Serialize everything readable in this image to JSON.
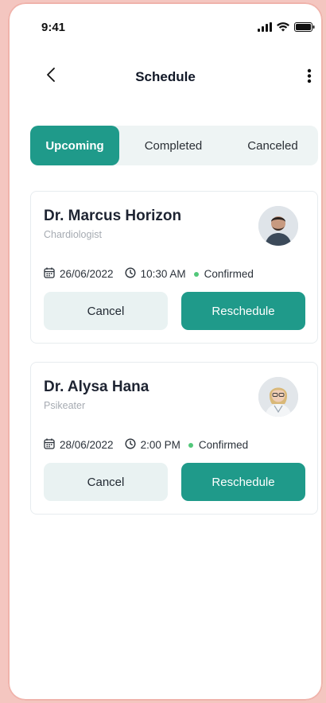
{
  "status_bar": {
    "time": "9:41"
  },
  "header": {
    "title": "Schedule"
  },
  "tabs": [
    {
      "label": "Upcoming",
      "active": true
    },
    {
      "label": "Completed",
      "active": false
    },
    {
      "label": "Canceled",
      "active": false
    }
  ],
  "appointments": [
    {
      "doctor": "Dr. Marcus Horizon",
      "specialty": "Chardiologist",
      "date": "26/06/2022",
      "time": "10:30 AM",
      "status": "Confirmed",
      "cancel_label": "Cancel",
      "reschedule_label": "Reschedule"
    },
    {
      "doctor": "Dr. Alysa Hana",
      "specialty": "Psikeater",
      "date": "28/06/2022",
      "time": "2:00 PM",
      "status": "Confirmed",
      "cancel_label": "Cancel",
      "reschedule_label": "Reschedule"
    }
  ],
  "colors": {
    "accent": "#1f9a8a",
    "status_confirmed": "#52c77a",
    "tab_bg": "#eef4f4"
  }
}
